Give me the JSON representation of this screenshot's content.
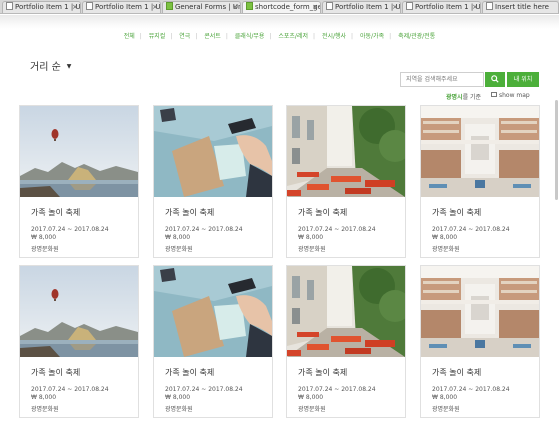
{
  "browser": {
    "tabs": [
      {
        "title": "Portfolio Item 1 | Un",
        "icon": "page-icon",
        "active": false
      },
      {
        "title": "Portfolio Item 1 | Ur",
        "icon": "page-icon",
        "active": false
      },
      {
        "title": "General Forms | Uni",
        "icon": "green-u-icon",
        "active": false
      },
      {
        "title": "shortcode_form_ge",
        "icon": "green-u-icon",
        "active": true
      },
      {
        "title": "Portfolio Item 1 | Ur",
        "icon": "page-icon",
        "active": false
      },
      {
        "title": "Portfolio Item 1 | Ur",
        "icon": "page-icon",
        "active": false
      },
      {
        "title": "Insert title here",
        "icon": "page-icon",
        "active": false
      }
    ],
    "close_glyph": "×"
  },
  "category_nav": [
    "전체",
    "뮤지컬",
    "연극",
    "콘서트",
    "클래식/무용",
    "스포츠/레저",
    "전시/행사",
    "아동/가족",
    "축제/관광/전통"
  ],
  "category_separator": "|",
  "sort": {
    "label": "거리 순",
    "arrow": "▼"
  },
  "search": {
    "placeholder": "지역을 검색해주세요",
    "button_icon": "magnifier-icon",
    "location_button": "내 위치"
  },
  "basis": {
    "location": "광명시",
    "suffix": "를 기준"
  },
  "map_toggle": {
    "label": "show map"
  },
  "colors": {
    "accent": "#4caf3a",
    "text": "#333333"
  },
  "cards": [
    {
      "image": "balloon-lake-photo",
      "title": "가족 놀이 축제",
      "date": "2017.07.24 ~ 2017.08.24",
      "price": "₩ 8,000",
      "venue": "광명문화원"
    },
    {
      "image": "desk-notebook-photo",
      "title": "가족 놀이 축제",
      "date": "2017.07.24 ~ 2017.08.24",
      "price": "₩ 8,000",
      "venue": "광명문화원"
    },
    {
      "image": "street-cafe-photo",
      "title": "가족 놀이 축제",
      "date": "2017.07.24 ~ 2017.08.24",
      "price": "₩ 8,000",
      "venue": "광명문화원"
    },
    {
      "image": "library-hall-photo",
      "title": "가족 놀이 축제",
      "date": "2017.07.24 ~ 2017.08.24",
      "price": "₩ 8,000",
      "venue": "광명문화원"
    },
    {
      "image": "balloon-lake-photo",
      "title": "가족 놀이 축제",
      "date": "2017.07.24 ~ 2017.08.24",
      "price": "₩ 8,000",
      "venue": "광명문화원"
    },
    {
      "image": "desk-notebook-photo",
      "title": "가족 놀이 축제",
      "date": "2017.07.24 ~ 2017.08.24",
      "price": "₩ 8,000",
      "venue": "광명문화원"
    },
    {
      "image": "street-cafe-photo",
      "title": "가족 놀이 축제",
      "date": "2017.07.24 ~ 2017.08.24",
      "price": "₩ 8,000",
      "venue": "광명문화원"
    },
    {
      "image": "library-hall-photo",
      "title": "가족 놀이 축제",
      "date": "2017.07.24 ~ 2017.08.24",
      "price": "₩ 8,000",
      "venue": "광명문화원"
    }
  ]
}
